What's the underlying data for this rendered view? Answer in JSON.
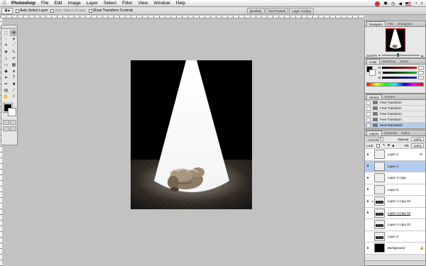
{
  "menubar": {
    "apple": "",
    "items": [
      "Photoshop",
      "File",
      "Edit",
      "Image",
      "Layer",
      "Select",
      "Filter",
      "View",
      "Window",
      "Help"
    ]
  },
  "optionsbar": {
    "auto_select_layer": "Auto Select Layer",
    "auto_select_groups": "Auto Select Groups",
    "show_transform_controls": "Show Transform Controls",
    "well_tabs": [
      "Brushes",
      "Tool Presets",
      "Layer Comps"
    ]
  },
  "panels": {
    "navigator": {
      "tabs": [
        "Navigator",
        "Info",
        "Histogram"
      ],
      "zoom": "16.67%"
    },
    "color": {
      "tabs": [
        "Color",
        "Swatches",
        "Styles"
      ],
      "sliders": [
        {
          "label": "R",
          "color": "#cc2222"
        },
        {
          "label": "G",
          "color": "#22aa22"
        },
        {
          "label": "B",
          "color": "#2222cc"
        }
      ]
    },
    "history": {
      "tabs": [
        "History",
        "Actions"
      ],
      "items": [
        {
          "label": "Free Transform",
          "selected": false
        },
        {
          "label": "Free Transform",
          "selected": false
        },
        {
          "label": "Free Transform",
          "selected": false
        },
        {
          "label": "Free Transform",
          "selected": false
        },
        {
          "label": "Send Backward",
          "selected": true
        }
      ]
    },
    "layers": {
      "tabs": [
        "Layers",
        "Channels",
        "Paths"
      ],
      "blend_mode": "Normal",
      "opacity_label": "Opacity:",
      "opacity_value": "100%",
      "lock_label": "Lock:",
      "fill_label": "Fill:",
      "fill_value": "100%",
      "items": [
        {
          "name": "Layer 2",
          "visible": true,
          "selected": false,
          "thumb": "checker",
          "underline": false,
          "linked": false
        },
        {
          "name": "Layer 4",
          "visible": true,
          "selected": true,
          "thumb": "checker",
          "underline": false,
          "linked": false
        },
        {
          "name": "Layer 2 copy",
          "visible": true,
          "selected": false,
          "thumb": "checker",
          "underline": false,
          "linked": false
        },
        {
          "name": "Layer 5",
          "visible": true,
          "selected": false,
          "thumb": "checker",
          "underline": false,
          "linked": false
        },
        {
          "name": "Layer 4 copy 34",
          "visible": true,
          "selected": false,
          "thumb": "strip",
          "underline": false,
          "linked": true
        },
        {
          "name": "Layer 4 copy 33",
          "visible": true,
          "selected": false,
          "thumb": "strip",
          "underline": true,
          "linked": false
        },
        {
          "name": "Layer 4 copy 32",
          "visible": false,
          "selected": false,
          "thumb": "strip",
          "underline": false,
          "linked": false
        },
        {
          "name": "Layer 3",
          "visible": false,
          "selected": false,
          "thumb": "strip",
          "underline": false,
          "linked": false
        },
        {
          "name": "Background",
          "visible": true,
          "selected": false,
          "thumb": "black",
          "underline": false,
          "linked": false,
          "locked": true
        }
      ]
    }
  },
  "colors": {
    "canvas_bg": "#c2c2c2",
    "selection": "#b3ccee",
    "beam": "#ffffff"
  }
}
